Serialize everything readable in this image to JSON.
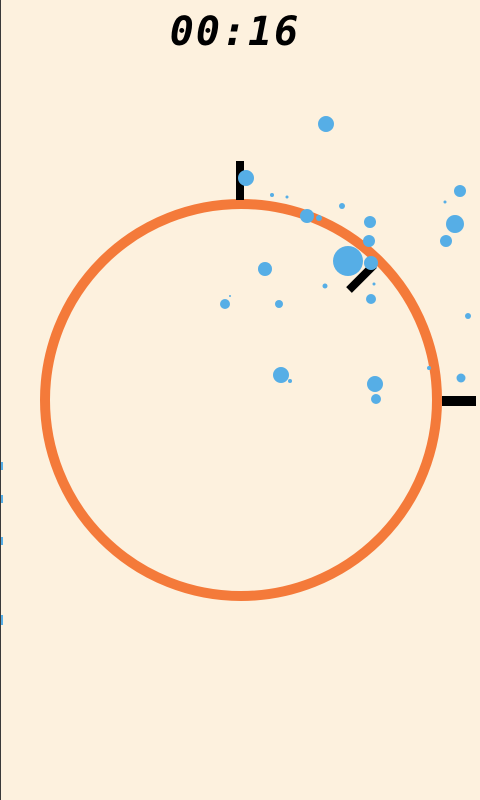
{
  "hud": {
    "timer": "00:16"
  },
  "colors": {
    "background": "#fdf1de",
    "ring": "#f47a3a",
    "bubble": "#56aee6",
    "marker": "#000000",
    "timer": "#000000"
  },
  "icons": {
    "ring": "ring-icon",
    "bubble": "bubble-icon",
    "marker": "tick-marker-icon"
  }
}
